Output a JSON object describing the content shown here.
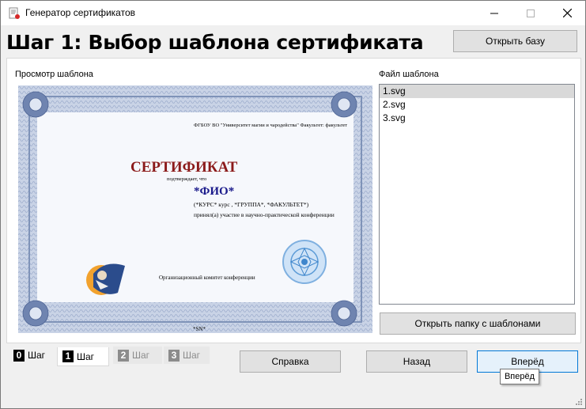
{
  "window": {
    "title": "Генератор сертификатов",
    "minimize": "—",
    "maximize": "☐",
    "close": "✕"
  },
  "heading": "Шаг 1: Выбор шаблона сертификата",
  "buttons": {
    "open_db": "Открыть базу",
    "open_folder": "Открыть папку с шаблонами",
    "help": "Справка",
    "back": "Назад",
    "next": "Вперёд"
  },
  "labels": {
    "preview": "Просмотр шаблона",
    "file": "Файл шаблона"
  },
  "files": [
    {
      "name": "1.svg",
      "selected": true
    },
    {
      "name": "2.svg",
      "selected": false
    },
    {
      "name": "3.svg",
      "selected": false
    }
  ],
  "certificate": {
    "org": "ФГБОУ ВО \"Университет магии и чародейства\" Факультет: факультет",
    "title": "СЕРТИФИКАТ",
    "confirms": "подтверждает, что",
    "name": "*ФИО*",
    "course": "(*КУРС* курс , *ГРУППА*, *ФАКУЛЬТЕТ*)",
    "participation": "принял(а) участие в научно-практической конференции",
    "committee": "Организационный комитет конференции",
    "serial": "*SN*"
  },
  "tabs": [
    {
      "num": "0",
      "label": "Шаг",
      "state": "done"
    },
    {
      "num": "1",
      "label": "Шаг",
      "state": "active"
    },
    {
      "num": "2",
      "label": "Шаг",
      "state": "disabled"
    },
    {
      "num": "3",
      "label": "Шаг",
      "state": "disabled"
    }
  ],
  "tooltip": "Вперёд",
  "colors": {
    "accent": "#0078d7",
    "cert_title": "#8b1a1a",
    "cert_name": "#1a1a8b",
    "cert_frame": "#7f93b8"
  }
}
